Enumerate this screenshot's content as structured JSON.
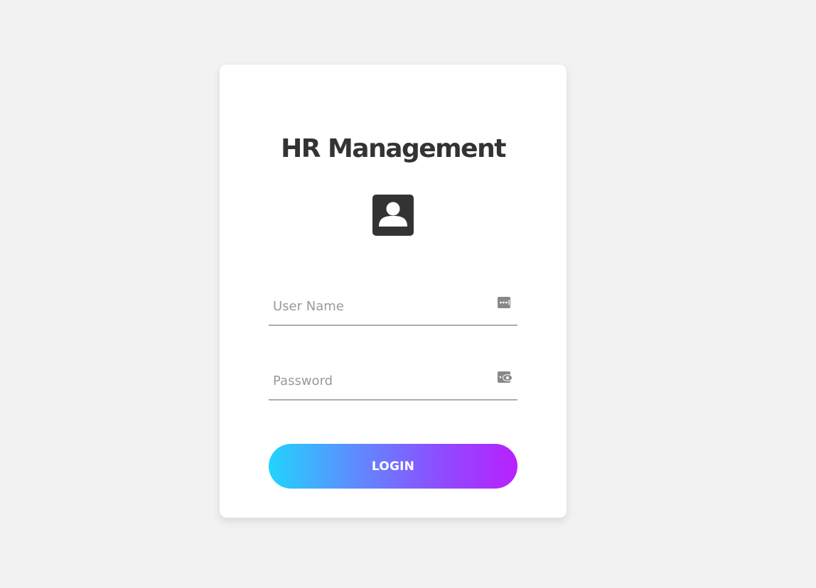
{
  "form": {
    "title": "HR Management",
    "avatar_icon": "account-box-icon",
    "username": {
      "placeholder": "User Name",
      "value": "",
      "icon": "password-dots-icon"
    },
    "password": {
      "placeholder": "Password",
      "value": "",
      "icon": "eye-toggle-icon"
    },
    "login_label": "LOGIN"
  },
  "colors": {
    "background": "#f2f2f2",
    "card": "#ffffff",
    "title": "#333333",
    "underline": "#adadad",
    "gradient_start": "#21d4fd",
    "gradient_end": "#b721ff"
  }
}
